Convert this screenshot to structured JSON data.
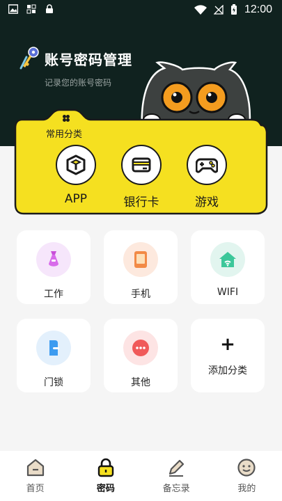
{
  "status_bar": {
    "time": "12:00"
  },
  "header": {
    "title": "账号密码管理",
    "subtitle": "记录您的账号密码"
  },
  "common": {
    "label": "常用分类",
    "items": [
      {
        "label": "APP",
        "icon": "cube-icon"
      },
      {
        "label": "银行卡",
        "icon": "card-icon"
      },
      {
        "label": "游戏",
        "icon": "gamepad-icon"
      }
    ]
  },
  "categories": [
    {
      "label": "工作",
      "icon": "tie-icon",
      "color": "#f6e6fb"
    },
    {
      "label": "手机",
      "icon": "phone-icon",
      "color": "#fde9de"
    },
    {
      "label": "WIFI",
      "icon": "wifi-house-icon",
      "color": "#e2f5ef"
    },
    {
      "label": "门锁",
      "icon": "door-icon",
      "color": "#e3f0fc"
    },
    {
      "label": "其他",
      "icon": "more-icon",
      "color": "#fde4e4"
    },
    {
      "label": "添加分类",
      "icon": "plus-icon"
    }
  ],
  "nav": [
    {
      "label": "首页",
      "icon": "home-icon"
    },
    {
      "label": "密码",
      "icon": "lock-icon",
      "active": true
    },
    {
      "label": "备忘录",
      "icon": "pencil-icon"
    },
    {
      "label": "我的",
      "icon": "smile-icon"
    }
  ],
  "colors": {
    "accent": "#f5e020",
    "dark": "#10221f"
  }
}
